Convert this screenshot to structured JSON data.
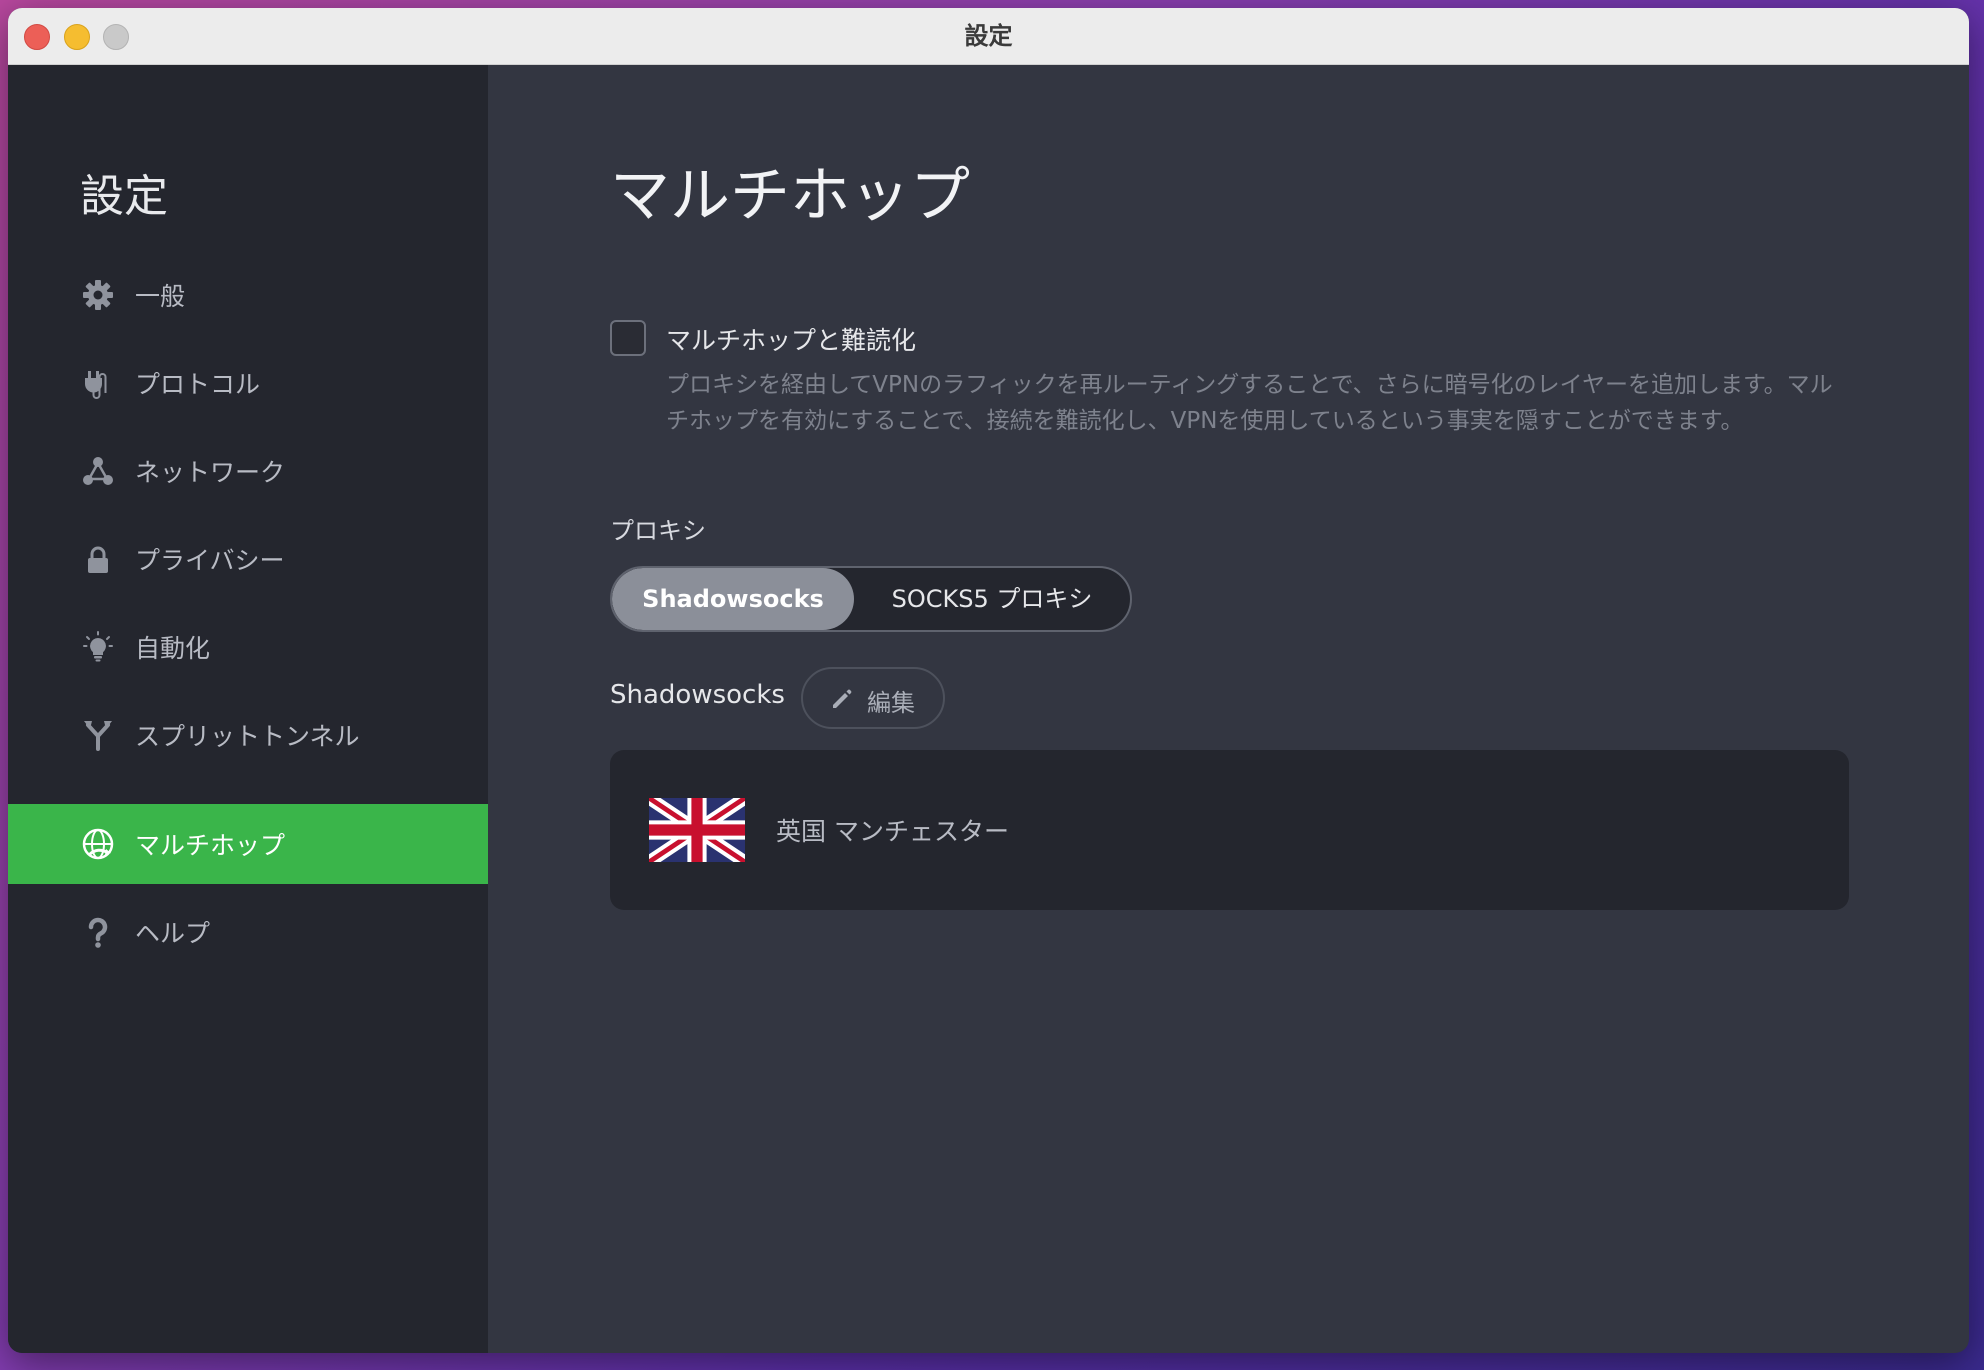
{
  "window": {
    "title": "設定"
  },
  "sidebar": {
    "title": "設定",
    "items": [
      {
        "label": "一般",
        "icon": "gear-icon",
        "active": false
      },
      {
        "label": "プロトコル",
        "icon": "plug-icon",
        "active": false
      },
      {
        "label": "ネットワーク",
        "icon": "network-icon",
        "active": false
      },
      {
        "label": "プライバシー",
        "icon": "lock-icon",
        "active": false
      },
      {
        "label": "自動化",
        "icon": "lightbulb-icon",
        "active": false
      },
      {
        "label": "スプリットトンネル",
        "icon": "split-tunnel-icon",
        "active": false
      },
      {
        "label": "マルチホップ",
        "icon": "globe-icon",
        "active": true
      },
      {
        "label": "ヘルプ",
        "icon": "question-icon",
        "active": false
      }
    ]
  },
  "main": {
    "title": "マルチホップ",
    "multihop_checkbox": {
      "label": "マルチホップと難読化",
      "checked": false,
      "description": "プロキシを経由してVPNのラフィックを再ルーティングすることで、さらに暗号化のレイヤーを追加します。マルチホップを有効にすることで、接続を難読化し、VPNを使用しているという事実を隠すことができます。"
    },
    "proxy": {
      "label": "プロキシ",
      "options": [
        "Shadowsocks",
        "SOCKS5 プロキシ"
      ],
      "selected": "Shadowsocks"
    },
    "shadowsocks": {
      "label": "Shadowsocks",
      "edit_label": "編集"
    },
    "server": {
      "name": "英国 マンチェスター",
      "flag": "uk-flag-icon"
    }
  },
  "colors": {
    "accent": "#3ab54a",
    "sidebar_bg": "#24262e",
    "main_bg": "#333641"
  }
}
